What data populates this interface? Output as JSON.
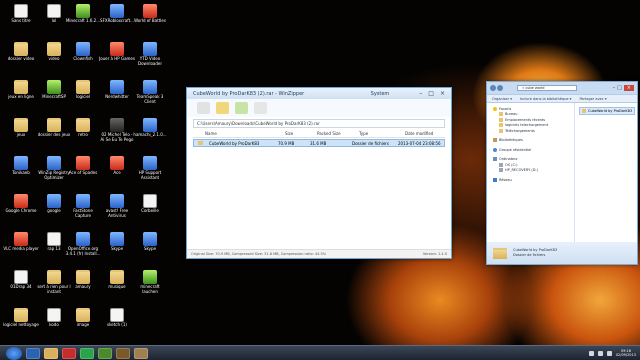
{
  "desktop": {
    "icons": [
      {
        "label": "Sans titre",
        "icon": "document-icon"
      },
      {
        "label": "lol",
        "icon": "document-icon"
      },
      {
        "label": "Minecraft 1.6.2...",
        "icon": "minecraft-icon"
      },
      {
        "label": "SFXRobloxcraft...",
        "icon": "app-icon"
      },
      {
        "label": "World of Battles",
        "icon": "game-icon"
      },
      {
        "label": "dossier video",
        "icon": "folder-icon"
      },
      {
        "label": "video",
        "icon": "folder-icon"
      },
      {
        "label": "Clownfish",
        "icon": "app-icon"
      },
      {
        "label": "Jouer à HP Games",
        "icon": "game-icon"
      },
      {
        "label": "YTD Video Downloader",
        "icon": "app-icon"
      },
      {
        "label": "jeux en ligne",
        "icon": "folder-icon"
      },
      {
        "label": "MinecraftSP",
        "icon": "minecraft-icon"
      },
      {
        "label": "logiciel",
        "icon": "folder-icon"
      },
      {
        "label": "Nerdwhitter",
        "icon": "app-icon"
      },
      {
        "label": "TeamSpeak 3 Client",
        "icon": "app-icon"
      },
      {
        "label": "jeux",
        "icon": "folder-icon"
      },
      {
        "label": "dossier des jeux",
        "icon": "folder-icon"
      },
      {
        "label": "retro",
        "icon": "folder-icon"
      },
      {
        "label": "02 Michel Telo - Ai Se Eu Te Pego",
        "icon": "media-icon"
      },
      {
        "label": "hamachi_2.1.0...",
        "icon": "app-icon"
      },
      {
        "label": "Tonikaeb",
        "icon": "app-icon"
      },
      {
        "label": "WinZip Registry Optimizer",
        "icon": "app-icon"
      },
      {
        "label": "Ace of Spades",
        "icon": "game-icon"
      },
      {
        "label": "Ace",
        "icon": "game-icon"
      },
      {
        "label": "HP Support Assistant",
        "icon": "app-icon"
      },
      {
        "label": "Google Chrome",
        "icon": "chrome-icon"
      },
      {
        "label": "google",
        "icon": "app-icon"
      },
      {
        "label": "FastStone Capture",
        "icon": "app-icon"
      },
      {
        "label": "avast! Free Antivirus",
        "icon": "app-icon"
      },
      {
        "label": "Corbeille",
        "icon": "recycle-bin-icon"
      },
      {
        "label": "VLC media player",
        "icon": "vlc-icon"
      },
      {
        "label": "rap 13",
        "icon": "document-icon"
      },
      {
        "label": "OpenOffice.org 3.4.1 (fr) Install...",
        "icon": "app-icon"
      },
      {
        "label": "Skype",
        "icon": "skype-icon"
      },
      {
        "label": "Skype",
        "icon": "skype-icon"
      },
      {
        "label": "01Drap 34",
        "icon": "document-icon"
      },
      {
        "label": "sert à rien pour l instant",
        "icon": "folder-icon"
      },
      {
        "label": "amaury",
        "icon": "folder-icon"
      },
      {
        "label": "musique",
        "icon": "folder-icon"
      },
      {
        "label": "minecraft lauchen",
        "icon": "minecraft-icon"
      },
      {
        "label": "logiciel nettoyage",
        "icon": "folder-icon"
      },
      {
        "label": "kodo",
        "icon": "document-icon"
      },
      {
        "label": "image",
        "icon": "folder-icon"
      },
      {
        "label": "sketch (1)",
        "icon": "document-icon"
      }
    ]
  },
  "winzip": {
    "title": "CubeWorld by ProDarK83 (2).rar - WinZipper",
    "system_label": "System",
    "path": "C:\\Users\\Amaury\\Downloads\\CubeWorld by ProDarK83 (2).rar",
    "columns": [
      "Name",
      "Size",
      "Packed Size",
      "Type",
      "Date modified"
    ],
    "rows": [
      {
        "name": "CubeWorld by ProDarK83",
        "size": "70.9 MB",
        "packed": "31.6 MB",
        "type": "Dossier de fichiers",
        "date": "2013-07-04 23:08:56"
      }
    ],
    "status": "Original Size: 70.9 MB, Compressed Size: 31.6 MB, Compression ratio: 44.5%",
    "version": "Version: 1.4.0"
  },
  "explorer": {
    "address": "« cube world",
    "commands": [
      "Organiser ▾",
      "Inclure dans la bibliothèque ▾",
      "Partager avec ▾"
    ],
    "nav": [
      {
        "label": "Favoris",
        "icon": "star-icon",
        "sub": false
      },
      {
        "label": "Bureau",
        "icon": "desktop-icon",
        "sub": true
      },
      {
        "label": "Emplacements récents",
        "icon": "folder-icon",
        "sub": true
      },
      {
        "label": "logiciels telechargement",
        "icon": "folder-icon",
        "sub": true
      },
      {
        "label": "Téléchargements",
        "icon": "folder-icon",
        "sub": true
      },
      {
        "label": "Bibliothèques",
        "icon": "library-icon",
        "sub": false
      },
      {
        "label": "Groupe résidentiel",
        "icon": "homegroup-icon",
        "sub": false
      },
      {
        "label": "Ordinateur",
        "icon": "computer-icon",
        "sub": false
      },
      {
        "label": "OS (C:)",
        "icon": "drive-icon",
        "sub": true
      },
      {
        "label": "HP_RECOVERY (D:)",
        "icon": "drive-icon",
        "sub": true
      },
      {
        "label": "Réseau",
        "icon": "network-icon",
        "sub": false
      }
    ],
    "file": "CubeWorld by ProDarK83",
    "details_name": "CubeWorld by ProDarK83",
    "details_type": "Dossier de fichiers"
  },
  "taskbar": {
    "clock_time": "09:16",
    "clock_date": "02/09/2013"
  }
}
